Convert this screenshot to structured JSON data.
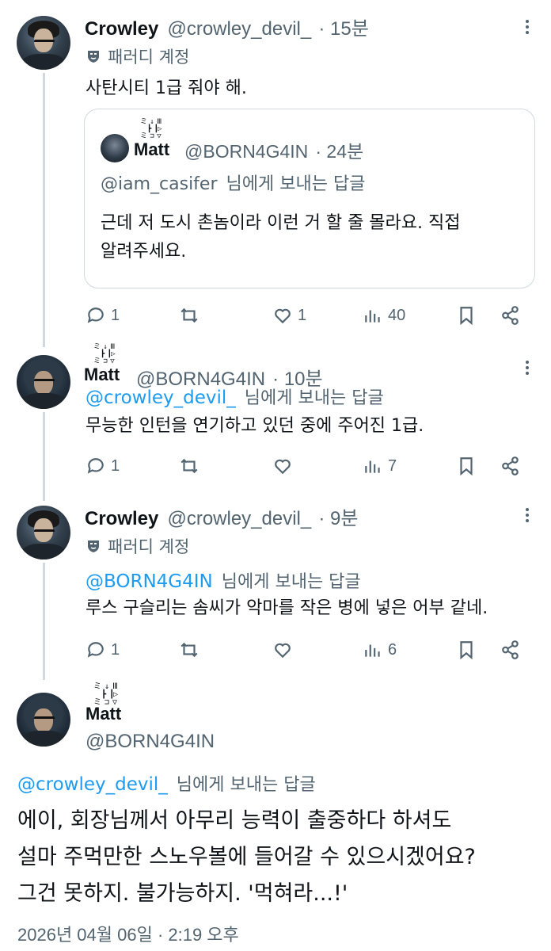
{
  "tweet1": {
    "name": "Crowley",
    "handle": "@crowley_devil_",
    "time": "· 15분",
    "badge": "패러디 계정",
    "text": "사탄시티 1급 줘야 해.",
    "quote": {
      "name": "Matt",
      "handle": "@BORN4G4IN",
      "time": "· 24분",
      "reply_handle": "@iam_casifer",
      "reply_suffix": "님에게 보내는 답글",
      "text_line1": "근데 저 도시 촌놈이라 이런 거 할 줄 몰라요. 직접",
      "text_line2": "알려주세요."
    },
    "replies": "1",
    "retweets": "",
    "likes": "1",
    "views": "40"
  },
  "tweet2": {
    "name": "Matt",
    "handle": "@BORN4G4IN",
    "time": "· 10분",
    "reply_handle": "@crowley_devil_",
    "reply_suffix": "님에게 보내는 답글",
    "text": "무능한 인턴을 연기하고 있던 중에 주어진 1급.",
    "replies": "1",
    "retweets": "",
    "likes": "",
    "views": "7"
  },
  "tweet3": {
    "name": "Crowley",
    "handle": "@crowley_devil_",
    "time": "· 9분",
    "badge": "패러디 계정",
    "reply_handle": "@BORN4G4IN",
    "reply_suffix": "님에게 보내는 답글",
    "text": "루스 구슬리는 솜씨가 악마를 작은 병에 넣은 어부 같네.",
    "replies": "1",
    "retweets": "",
    "likes": "",
    "views": "6"
  },
  "tweet4": {
    "name": "Matt",
    "handle": "@BORN4G4IN",
    "reply_handle": "@crowley_devil_",
    "reply_suffix": "님에게 보내는 답글",
    "text_line1": "에이, 회장님께서 아무리 능력이 출중하다 하셔도",
    "text_line2": "설마 주먹만한 스노우볼에 들어갈 수 있으시겠어요?",
    "text_line3": "그건 못하지. 불가능하지. '먹혀라...!'",
    "timestamp": "2026년 04월 06일 · 2:19 오후"
  },
  "icons": {
    "reply": "reply-icon",
    "retweet": "retweet-icon",
    "like": "heart-icon",
    "views": "views-icon",
    "bookmark": "bookmark-icon",
    "share": "share-icon",
    "more": "more-icon",
    "parody": "mask-icon"
  },
  "colors": {
    "link": "#1d9bf0",
    "muted": "#536471",
    "text": "#0f1419",
    "border": "#cfd9de"
  }
}
